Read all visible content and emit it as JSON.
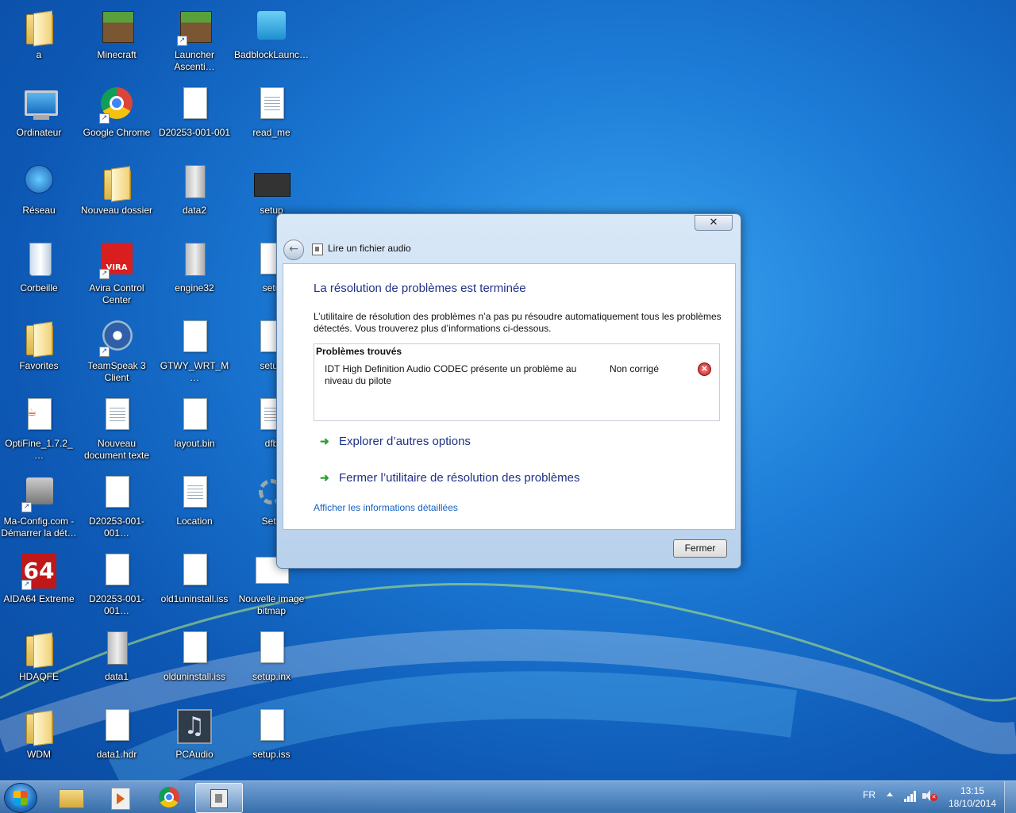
{
  "desktop": {
    "icons": [
      {
        "label": "a",
        "icon": "user-folder-icon"
      },
      {
        "label": "Minecraft",
        "icon": "minecraft-icon"
      },
      {
        "label": "Launcher Ascenti…",
        "icon": "launcher-icon"
      },
      {
        "label": "BadblockLaunc…",
        "icon": "badblock-icon"
      },
      {
        "label": "Ordinateur",
        "icon": "computer-icon"
      },
      {
        "label": "Google Chrome",
        "icon": "chrome-icon"
      },
      {
        "label": "D20253-001-001",
        "icon": "calendar-file-icon"
      },
      {
        "label": "read_me",
        "icon": "text-file-icon"
      },
      {
        "label": "Réseau",
        "icon": "network-icon"
      },
      {
        "label": "Nouveau dossier",
        "icon": "folder-icon"
      },
      {
        "label": "data2",
        "icon": "cabinet-icon"
      },
      {
        "label": "setup",
        "icon": "setup-board-icon"
      },
      {
        "label": "Corbeille",
        "icon": "recycle-bin-icon"
      },
      {
        "label": "Avira Control Center",
        "icon": "avira-icon"
      },
      {
        "label": "engine32",
        "icon": "cabinet-icon"
      },
      {
        "label": "setu",
        "icon": "setup-icon"
      },
      {
        "label": "Favorites",
        "icon": "folder-icon"
      },
      {
        "label": "TeamSpeak 3 Client",
        "icon": "teamspeak-icon"
      },
      {
        "label": "GTWY_WRT_M…",
        "icon": "file-icon"
      },
      {
        "label": "setup",
        "icon": "file-icon"
      },
      {
        "label": "OptiFine_1.7.2_…",
        "icon": "java-file-icon"
      },
      {
        "label": "Nouveau document texte",
        "icon": "text-file-icon"
      },
      {
        "label": "layout.bin",
        "icon": "file-icon"
      },
      {
        "label": "dfb",
        "icon": "window-file-icon"
      },
      {
        "label": "Ma-Config.com - Démarrer la dét…",
        "icon": "maconfig-icon"
      },
      {
        "label": "D20253-001-001…",
        "icon": "file-icon"
      },
      {
        "label": "Location",
        "icon": "text-file-icon"
      },
      {
        "label": "Setu",
        "icon": "gear-icon"
      },
      {
        "label": "AIDA64 Extreme",
        "icon": "aida64-icon"
      },
      {
        "label": "D20253-001-001…",
        "icon": "file-icon"
      },
      {
        "label": "old1uninstall.iss",
        "icon": "file-icon"
      },
      {
        "label": "Nouvelle image bitmap",
        "icon": "bitmap-icon"
      },
      {
        "label": "HDAQFE",
        "icon": "folder-icon"
      },
      {
        "label": "data1",
        "icon": "cabinet-icon"
      },
      {
        "label": "olduninstall.iss",
        "icon": "file-icon"
      },
      {
        "label": "setup.inx",
        "icon": "file-icon"
      },
      {
        "label": "WDM",
        "icon": "folder-icon"
      },
      {
        "label": "data1.hdr",
        "icon": "file-icon"
      },
      {
        "label": "PCAudio",
        "icon": "music-icon"
      },
      {
        "label": "setup.iss",
        "icon": "file-icon"
      }
    ]
  },
  "dialog": {
    "close_label": "✕",
    "back_label": "←",
    "title": "Lire un fichier audio",
    "heading": "La résolution de problèmes est terminée",
    "description": "L’utilitaire de résolution des problèmes n’a pas pu résoudre automatiquement tous les problèmes détectés. Vous trouverez plus d’informations ci-dessous.",
    "problems_header": "Problèmes trouvés",
    "problem": {
      "text": "IDT High Definition Audio CODEC présente un problème au niveau du pilote",
      "status": "Non corrigé"
    },
    "options": [
      {
        "label": "Explorer d’autres options"
      },
      {
        "label": "Fermer l’utilitaire de résolution des problèmes"
      }
    ],
    "details_link": "Afficher les informations détaillées",
    "close_button": "Fermer"
  },
  "taskbar": {
    "language": "FR",
    "time": "13:15",
    "date": "18/10/2014"
  }
}
